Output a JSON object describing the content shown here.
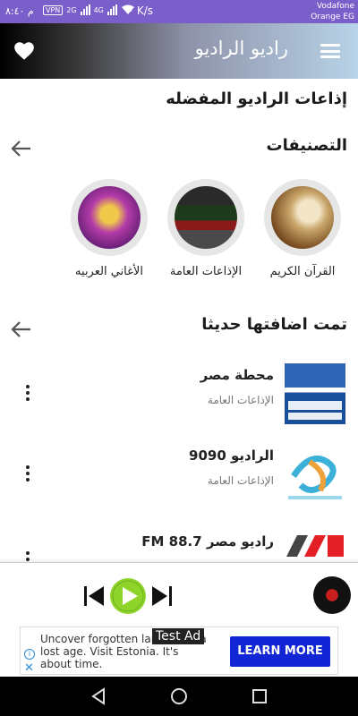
{
  "status_bar": {
    "time": "م ٨:٤٠",
    "vpn_chip": "VPN",
    "net_2g": "2G",
    "net_4g": "4G",
    "speed": "• K/s",
    "carrier_line1": "Vodafone",
    "carrier_line2": "Orange EG"
  },
  "header": {
    "title": "راديو الراديو",
    "menu_icon": "hamburger-icon",
    "favorite_icon": "heart-icon"
  },
  "favorites_heading": "إذاعات الراديو المفضله",
  "categories": {
    "heading": "التصنيفات",
    "items": [
      {
        "label": "القرآن الكريم",
        "icon": "quran-image"
      },
      {
        "label": "الإذاعات العامة",
        "icon": "radio-studio-image"
      },
      {
        "label": "الأغاني العربيه",
        "icon": "arabic-songs-image"
      }
    ]
  },
  "recent": {
    "heading": "تمت اضافتها حديثا",
    "stations": [
      {
        "name": "محطة مصر",
        "category": "الإذاعات العامة"
      },
      {
        "name": "الراديو 9090",
        "category": "الإذاعات العامة"
      },
      {
        "name": "راديو مصر FM 88.7",
        "category": ""
      }
    ]
  },
  "player": {
    "prev_icon": "skip-previous-icon",
    "play_icon": "play-icon",
    "next_icon": "skip-next-icon",
    "record_icon": "vinyl-record-icon"
  },
  "ad": {
    "text": "Uncover forgotten lan... from a lost age. Visit Estonia. It's about time.",
    "cta": "LEARN MORE",
    "badge": "Test Ad",
    "info_icon": "i",
    "close_icon": "✕"
  },
  "colors": {
    "status_bar": "#7a5ec9",
    "play_button": "#8fd42a",
    "cta": "#1226d6"
  }
}
